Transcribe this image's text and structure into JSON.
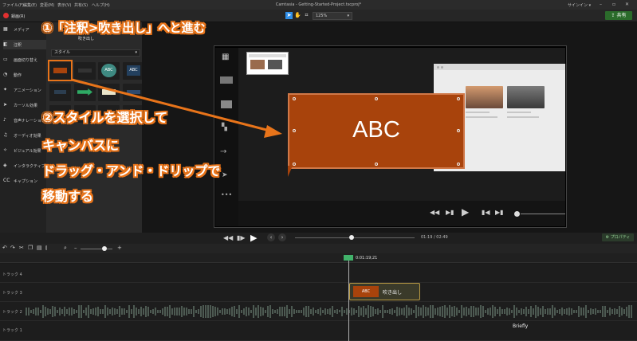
{
  "menu": {
    "items": [
      "ファイル(F)",
      "編集(E)",
      "変更(M)",
      "表示(V)",
      "共有(S)",
      "ヘルプ(H)"
    ],
    "window_title": "Camtasia - Getting-Started-Project.tscproj*",
    "signin": "サインイン ▾",
    "window_buttons": [
      "–",
      "▫",
      "✕"
    ]
  },
  "toolbar": {
    "record_label": "録画(R)",
    "zoom": "125%",
    "share_label": "共有"
  },
  "sidebar": {
    "items": [
      {
        "label": "メディア",
        "icon": "media-icon"
      },
      {
        "label": "注釈",
        "icon": "annotation-icon",
        "active": true
      },
      {
        "label": "画面切り替え",
        "icon": "transition-icon"
      },
      {
        "label": "動作",
        "icon": "behavior-icon"
      },
      {
        "label": "アニメーション",
        "icon": "animation-icon"
      },
      {
        "label": "カーソル効果",
        "icon": "cursor-icon"
      },
      {
        "label": "音声ナレーション",
        "icon": "mic-icon"
      },
      {
        "label": "オーディオ効果",
        "icon": "audio-icon"
      },
      {
        "label": "ビジュアル効果",
        "icon": "visual-icon"
      },
      {
        "label": "インタラクティブ機能",
        "icon": "interactive-icon"
      },
      {
        "label": "キャプション",
        "icon": "caption-icon"
      }
    ]
  },
  "panel": {
    "title": "吹き出し",
    "style_select": "スタイル",
    "thumbs": [
      "",
      "",
      "ABC",
      "ABC",
      "",
      "",
      "",
      "",
      "",
      "",
      "",
      ""
    ]
  },
  "canvas": {
    "callout_text": "ABC"
  },
  "transport": {
    "time_current": "01:19",
    "time_total": "02:49",
    "properties_label": "プロパティ"
  },
  "timeline": {
    "playhead_time": "0:01:19;21",
    "ruler": [
      "0:00:57;00",
      "0:01:00;00",
      "0:01:03;00",
      "0:01:06;00",
      "0:01:09;00",
      "0:01:12;00",
      "0:01:15;00",
      "0:01:18;00",
      "0:01:21;00",
      "0:01:24;00",
      "0:01:27;00",
      "0:01:30;00",
      "0:01:33;00",
      "0:01:36;00",
      "0:01:39;00"
    ],
    "tracks": [
      "トラック 4",
      "トラック 3",
      "トラック 2",
      "トラック 1"
    ],
    "clip_chip": "ABC",
    "clip_label": "吹き出し",
    "track1_text": "Briefly"
  },
  "annotations": {
    "step1": "①「注釈>吹き出し」へと進む",
    "step2_line1": "②スタイルを選択して",
    "step2_line2": "キャンバスに",
    "step2_line3": "ドラッグ・アンド・ドリップで",
    "step2_line4": "移動する",
    "accent_color": "#e8741a"
  }
}
